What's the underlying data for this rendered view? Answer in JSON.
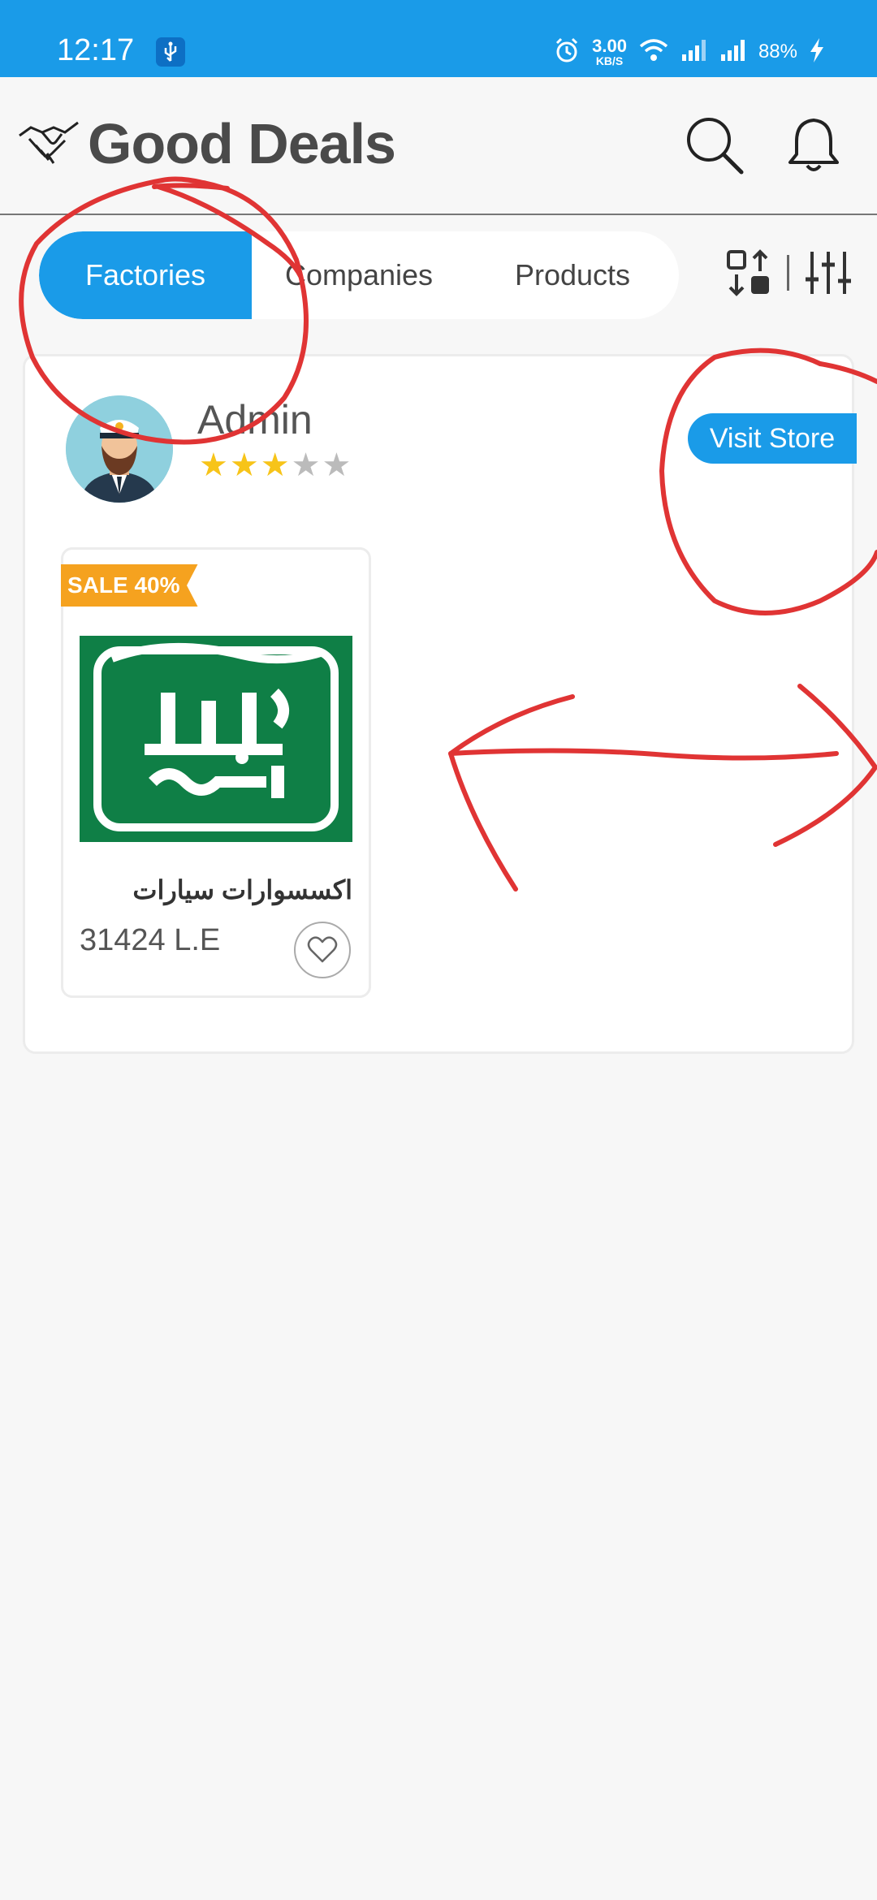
{
  "status_bar": {
    "time": "12:17",
    "net_speed_value": "3.00",
    "net_speed_unit": "KB/S",
    "battery": "88%",
    "icons": [
      "usb-icon",
      "alarm-icon",
      "wifi-icon",
      "signal-icon",
      "signal-icon",
      "charging-icon"
    ]
  },
  "header": {
    "title": "Good Deals",
    "logo_icon": "handshake-icon",
    "search_icon": "search-icon",
    "bell_icon": "bell-icon"
  },
  "tabs": [
    {
      "label": "Factories",
      "active": true
    },
    {
      "label": "Companies",
      "active": false
    },
    {
      "label": "Products",
      "active": false
    }
  ],
  "tools": {
    "sort_icon": "sort-icon",
    "filter_icon": "filter-sliders-icon"
  },
  "store": {
    "name": "Admin",
    "rating": 3,
    "rating_max": 5,
    "visit_label": "Visit Store",
    "product": {
      "badge": "SALE 40%",
      "name": "اكسسوارات سيارات",
      "price": "31424 L.E",
      "favorite_icon": "heart-icon"
    }
  },
  "colors": {
    "primary": "#1a9be8",
    "sale": "#f5a21f",
    "star": "#f7c419",
    "annotation": "#e03434",
    "product_bg": "#0f7f46"
  }
}
